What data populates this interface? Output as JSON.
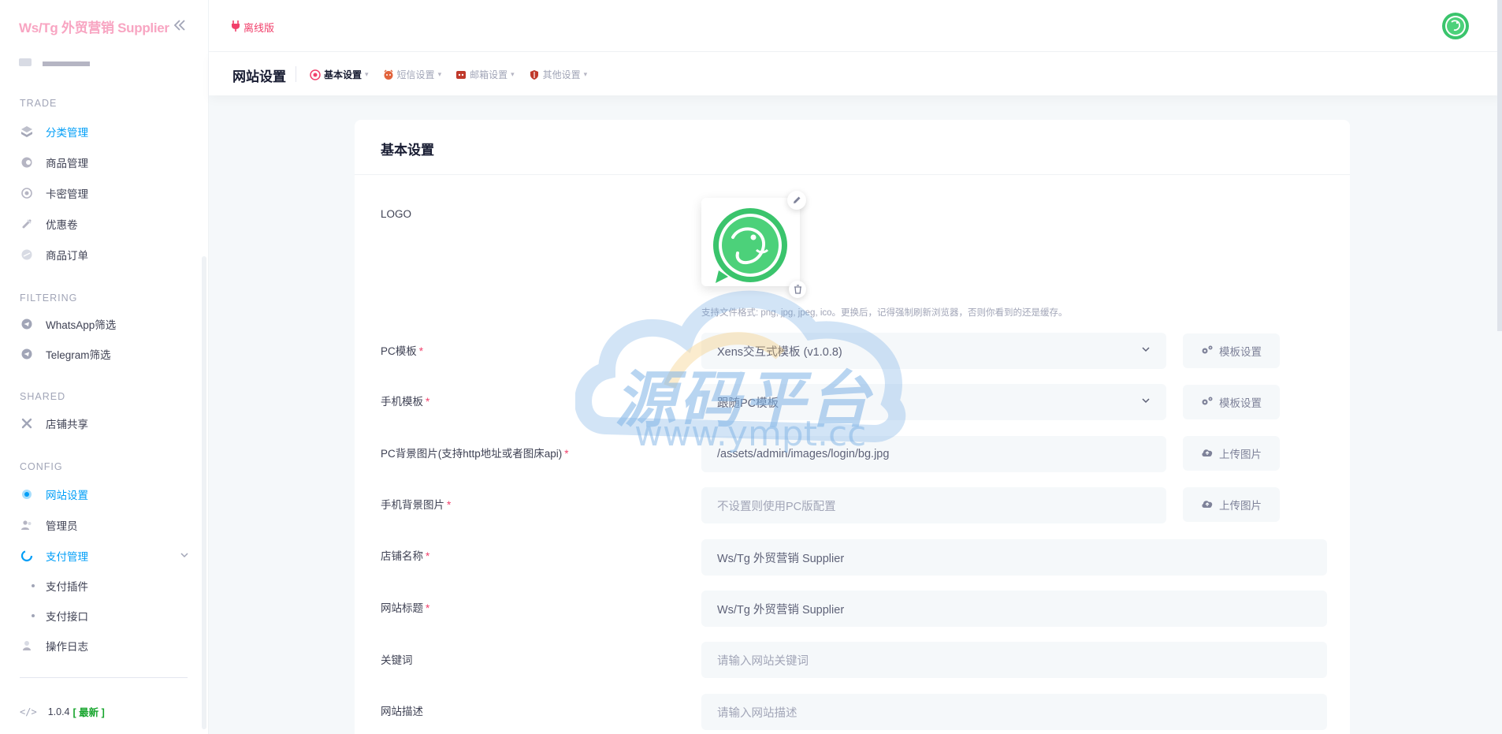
{
  "brand": {
    "title": "Ws/Tg 外贸营销 Supplier",
    "collapse_icon": "double-chevron-left"
  },
  "sidebar": {
    "sections": [
      {
        "title": "TRADE",
        "items": [
          {
            "label": "分类管理",
            "icon": "category-icon",
            "active": true
          },
          {
            "label": "商品管理",
            "icon": "goods-icon"
          },
          {
            "label": "卡密管理",
            "icon": "card-icon"
          },
          {
            "label": "优惠卷",
            "icon": "coupon-icon"
          },
          {
            "label": "商品订单",
            "icon": "order-icon"
          }
        ]
      },
      {
        "title": "FILTERING",
        "items": [
          {
            "label": "WhatsApp筛选",
            "icon": "telegram-icon"
          },
          {
            "label": "Telegram筛选",
            "icon": "telegram-icon"
          }
        ]
      },
      {
        "title": "SHARED",
        "items": [
          {
            "label": "店铺共享",
            "icon": "share-icon"
          }
        ]
      },
      {
        "title": "CONFIG",
        "items": [
          {
            "label": "网站设置",
            "icon": "gear-icon",
            "active": true
          },
          {
            "label": "管理员",
            "icon": "users-icon"
          },
          {
            "label": "支付管理",
            "icon": "payment-icon",
            "active": true,
            "expanded": true,
            "children": [
              {
                "label": "支付插件"
              },
              {
                "label": "支付接口"
              }
            ]
          },
          {
            "label": "操作日志",
            "icon": "log-icon"
          }
        ]
      }
    ],
    "version": {
      "number": "1.0.4",
      "badge": "[ 最新 ]"
    }
  },
  "header": {
    "offline_label": "离线版"
  },
  "toolbar": {
    "title": "网站设置",
    "tabs": [
      {
        "label": "基本设置",
        "active": true
      },
      {
        "label": "短信设置"
      },
      {
        "label": "邮箱设置"
      },
      {
        "label": "其他设置"
      }
    ]
  },
  "card": {
    "title": "基本设置",
    "logo": {
      "label": "LOGO",
      "hint": "支持文件格式: png, jpg, jpeg, ico。更换后，记得强制刷新浏览器，否则你看到的还是缓存。"
    },
    "fields": {
      "pc_template": {
        "label": "PC模板",
        "value": "Xens交互式模板 (v1.0.8)",
        "button": "模板设置"
      },
      "mobile_template": {
        "label": "手机模板",
        "value": "跟随PC模板",
        "button": "模板设置"
      },
      "pc_bg": {
        "label": "PC背景图片(支持http地址或者图床api)",
        "value": "/assets/admin/images/login/bg.jpg",
        "button": "上传图片"
      },
      "mobile_bg": {
        "label": "手机背景图片",
        "placeholder": "不设置则使用PC版配置",
        "button": "上传图片"
      },
      "shop_name": {
        "label": "店铺名称",
        "value": "Ws/Tg 外贸营销 Supplier"
      },
      "site_title": {
        "label": "网站标题",
        "value": "Ws/Tg 外贸营销 Supplier"
      },
      "keywords": {
        "label": "关键词",
        "placeholder": "请输入网站关键词"
      },
      "description": {
        "label": "网站描述",
        "placeholder": "请输入网站描述"
      }
    },
    "required_mark": "*"
  },
  "watermark": {
    "text": "源码平台",
    "url": "www.ympt.cc"
  },
  "colors": {
    "accent": "#009ef7",
    "brand": "#f8a5c2",
    "danger": "#f1416c",
    "success": "#17a52d"
  }
}
